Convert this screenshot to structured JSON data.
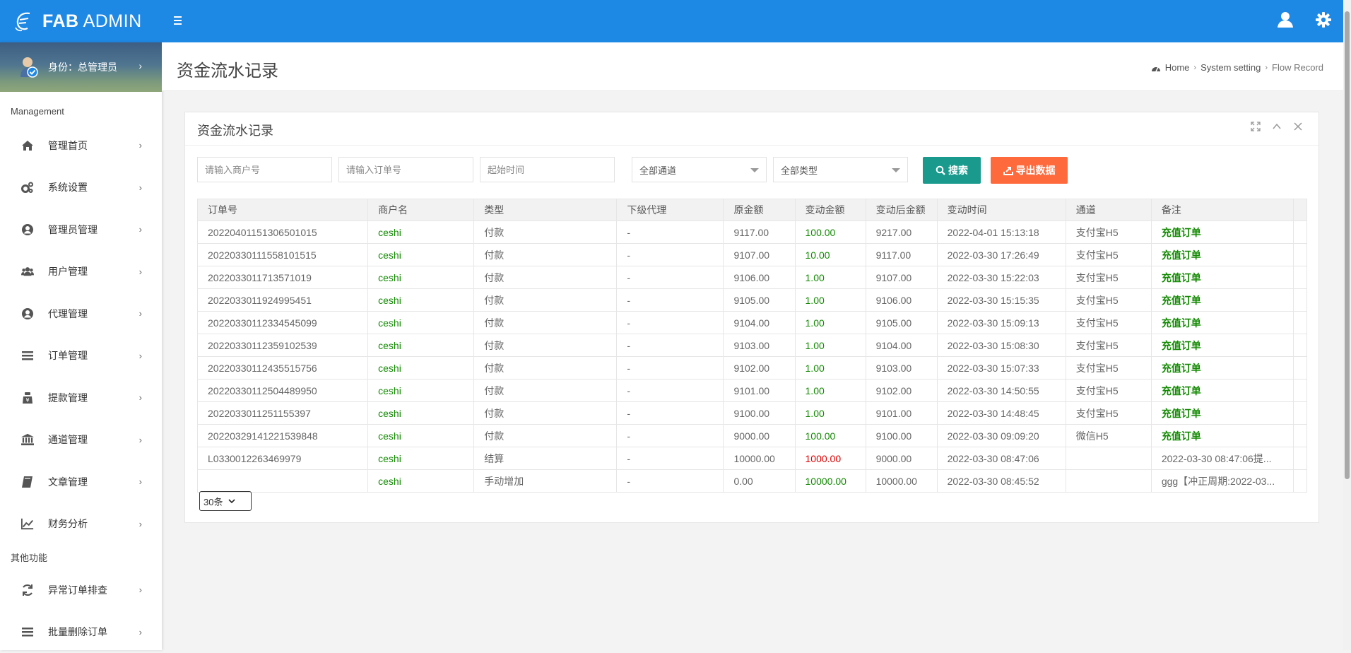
{
  "header": {
    "brand_bold": "FAB",
    "brand_light": "ADMIN",
    "icons": [
      "menu-icon",
      "user-icon",
      "gear-icon"
    ],
    "color": "#1e88e5"
  },
  "sidebar": {
    "profile_role": "身份：总管理员",
    "sections": [
      {
        "title": "Management",
        "items": [
          {
            "label": "管理首页",
            "icon": "home-icon"
          },
          {
            "label": "系统设置",
            "icon": "settings-icon"
          },
          {
            "label": "管理员管理",
            "icon": "user-circle-icon"
          },
          {
            "label": "用户管理",
            "icon": "users-icon"
          },
          {
            "label": "代理管理",
            "icon": "user-circle-icon"
          },
          {
            "label": "订单管理",
            "icon": "list-icon"
          },
          {
            "label": "提款管理",
            "icon": "withdraw-icon"
          },
          {
            "label": "通道管理",
            "icon": "bank-icon"
          },
          {
            "label": "文章管理",
            "icon": "book-icon"
          },
          {
            "label": "财务分析",
            "icon": "chart-icon"
          }
        ]
      },
      {
        "title": "其他功能",
        "items": [
          {
            "label": "异常订单排查",
            "icon": "refresh-icon"
          },
          {
            "label": "批量删除订单",
            "icon": "list-icon"
          }
        ]
      }
    ]
  },
  "page": {
    "title": "资金流水记录",
    "breadcrumb": [
      "Home",
      "System setting",
      "Flow Record"
    ]
  },
  "panel": {
    "title": "资金流水记录",
    "filters": {
      "merchant_placeholder": "请输入商户号",
      "order_placeholder": "请输入订单号",
      "start_placeholder": "起始时间",
      "channel_select": "全部通道",
      "type_select": "全部类型",
      "search_label": "搜索",
      "export_label": "导出数据"
    },
    "columns": [
      "订单号",
      "商户名",
      "类型",
      "下级代理",
      "原金额",
      "变动金额",
      "变动后金额",
      "变动时间",
      "通道",
      "备注"
    ],
    "rows": [
      [
        "20220401151306501015",
        "ceshi",
        "付款",
        "-",
        "9117.00",
        "100.00",
        "9217.00",
        "2022-04-01 15:13:18",
        "支付宝H5",
        "充值订单"
      ],
      [
        "20220330111558101515",
        "ceshi",
        "付款",
        "-",
        "9107.00",
        "10.00",
        "9117.00",
        "2022-03-30 17:26:49",
        "支付宝H5",
        "充值订单"
      ],
      [
        "2022033011713571019",
        "ceshi",
        "付款",
        "-",
        "9106.00",
        "1.00",
        "9107.00",
        "2022-03-30 15:22:03",
        "支付宝H5",
        "充值订单"
      ],
      [
        "2022033011924995451",
        "ceshi",
        "付款",
        "-",
        "9105.00",
        "1.00",
        "9106.00",
        "2022-03-30 15:15:35",
        "支付宝H5",
        "充值订单"
      ],
      [
        "20220330112334545099",
        "ceshi",
        "付款",
        "-",
        "9104.00",
        "1.00",
        "9105.00",
        "2022-03-30 15:09:13",
        "支付宝H5",
        "充值订单"
      ],
      [
        "20220330112359102539",
        "ceshi",
        "付款",
        "-",
        "9103.00",
        "1.00",
        "9104.00",
        "2022-03-30 15:08:30",
        "支付宝H5",
        "充值订单"
      ],
      [
        "20220330112435515756",
        "ceshi",
        "付款",
        "-",
        "9102.00",
        "1.00",
        "9103.00",
        "2022-03-30 15:07:33",
        "支付宝H5",
        "充值订单"
      ],
      [
        "20220330112504489950",
        "ceshi",
        "付款",
        "-",
        "9101.00",
        "1.00",
        "9102.00",
        "2022-03-30 14:50:55",
        "支付宝H5",
        "充值订单"
      ],
      [
        "2022033011251155397",
        "ceshi",
        "付款",
        "-",
        "9100.00",
        "1.00",
        "9101.00",
        "2022-03-30 14:48:45",
        "支付宝H5",
        "充值订单"
      ],
      [
        "20220329141221539848",
        "ceshi",
        "付款",
        "-",
        "9000.00",
        "100.00",
        "9100.00",
        "2022-03-30 09:09:20",
        "微信H5",
        "充值订单"
      ],
      [
        "L0330012263469979",
        "ceshi",
        "结算",
        "-",
        "10000.00",
        "1000.00",
        "9000.00",
        "2022-03-30 08:47:06",
        "",
        "2022-03-30 08:47:06提..."
      ],
      [
        "",
        "ceshi",
        "手动增加",
        "-",
        "0.00",
        "10000.00",
        "10000.00",
        "2022-03-30 08:45:52",
        "",
        "ggg【冲正周期:2022-03..."
      ]
    ],
    "page_size": "30条"
  },
  "colors": {
    "search_button": "#199a8c",
    "export_button": "#ff6a3d",
    "positive": "#118a00",
    "negative": "#e00000"
  }
}
